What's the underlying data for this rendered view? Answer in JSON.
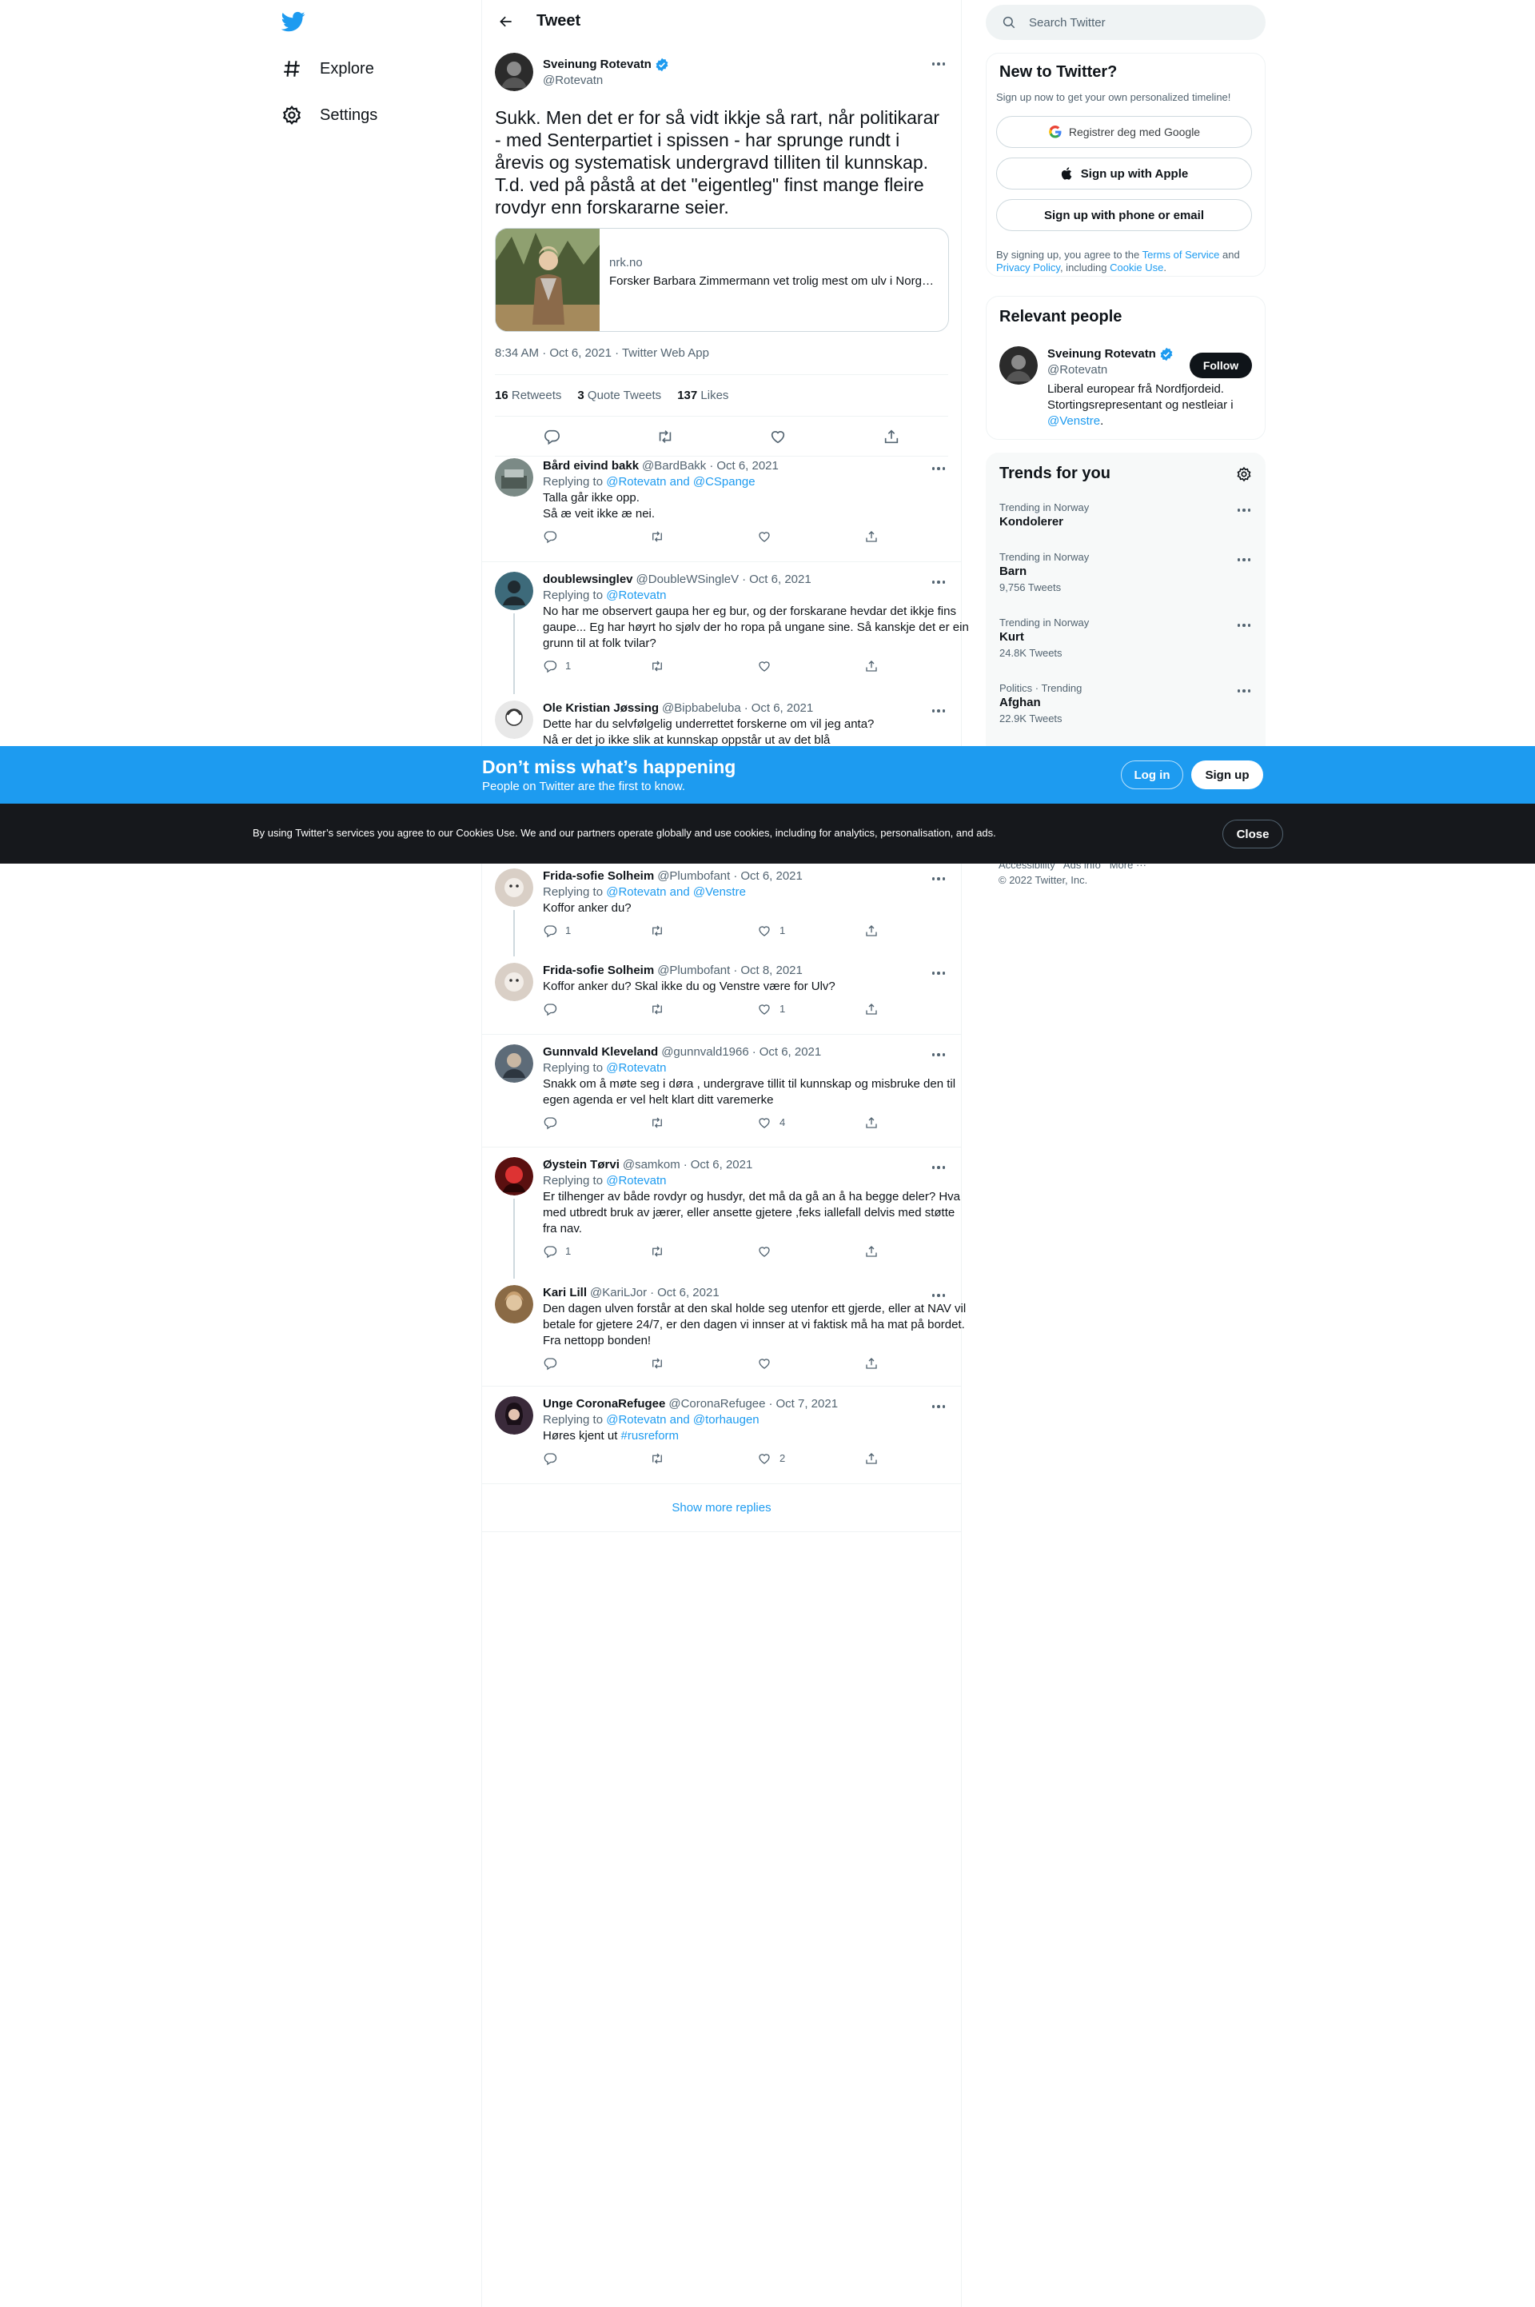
{
  "nav": {
    "items": [
      {
        "label": "Explore",
        "icon": "hashtag-icon"
      },
      {
        "label": "Settings",
        "icon": "gear-icon"
      }
    ]
  },
  "header": {
    "title": "Tweet"
  },
  "main_tweet": {
    "name": "Sveinung Rotevatn",
    "handle": "@Rotevatn",
    "text": "Sukk. Men det er for så vidt ikkje så rart, når politikarar - med Senterpartiet i spissen - har sprunge rundt i årevis og systematisk undergravd tilliten til kunnskap. T.d. ved på påstå at det \"eigentleg\" finst mange fleire rovdyr enn forskararne seier.",
    "card": {
      "domain": "nrk.no",
      "title": "Forsker Barbara Zimmermann vet trolig mest om ulv i Norge …"
    },
    "meta": "8:34 AM · Oct 6, 2021 · Twitter Web App",
    "stats": {
      "retweets_count": "16",
      "retweets_label": "Retweets",
      "quotes_count": "3",
      "quotes_label": "Quote Tweets",
      "likes_count": "137",
      "likes_label": "Likes"
    }
  },
  "replies": [
    {
      "name": "Bård eivind bakk",
      "handle": "@BardBakk",
      "date": "Oct 6, 2021",
      "replying_prefix": "Replying to ",
      "replying_to": "@Rotevatn and @CSpange",
      "text": "Talla går ikke opp.\nSå æ veit ikke æ nei.",
      "reply_count": "",
      "like_count": ""
    },
    {
      "name": "doublewsinglev",
      "handle": "@DoubleWSingleV",
      "date": "Oct 6, 2021",
      "replying_prefix": "Replying to ",
      "replying_to": "@Rotevatn",
      "text": "No har me observert gaupa her eg bur, og der forskarane hevdar det ikkje fins gaupe... Eg har høyrt ho sjølv der ho ropa på ungane sine. Så kanskje det er ein grunn til at folk tvilar?",
      "reply_count": "1",
      "like_count": ""
    },
    {
      "name": "Ole Kristian Jøssing",
      "handle": "@Bipbabeluba",
      "date": "Oct 6, 2021",
      "text": "Dette har du selvfølgelig underrettet forskerne om vil jeg anta?\nNå er det jo ikke slik at kunnskap oppstår ut av det blå"
    },
    {
      "name": "Frida-sofie Solheim",
      "handle": "@Plumbofant",
      "date": "Oct 6, 2021",
      "replying_prefix": "Replying to ",
      "replying_to": "@Rotevatn and @Venstre",
      "text": "Koffor anker du?",
      "reply_count": "1",
      "like_count": "1"
    },
    {
      "name": "Frida-sofie Solheim",
      "handle": "@Plumbofant",
      "date": "Oct 8, 2021",
      "text": "Koffor anker du? Skal ikke du og Venstre være for Ulv?",
      "reply_count": "",
      "like_count": "1"
    },
    {
      "name": "Gunnvald Kleveland",
      "handle": "@gunnvald1966",
      "date": "Oct 6, 2021",
      "replying_prefix": "Replying to ",
      "replying_to": "@Rotevatn",
      "text": "Snakk om å møte seg i døra , undergrave tillit til kunnskap og misbruke den til egen agenda er vel helt klart ditt varemerke",
      "reply_count": "",
      "like_count": "4"
    },
    {
      "name": "Øystein Tørvi",
      "handle": "@samkom",
      "date": "Oct 6, 2021",
      "replying_prefix": "Replying to ",
      "replying_to": "@Rotevatn",
      "text": "Er tilhenger av både rovdyr og husdyr, det må da gå an å ha begge deler? Hva med utbredt bruk av jærer, eller ansette gjetere ,feks iallefall delvis med støtte fra nav.",
      "reply_count": "1",
      "like_count": ""
    },
    {
      "name": "Kari Lill",
      "handle": "@KariLJor",
      "date": "Oct 6, 2021",
      "text": "Den dagen ulven forstår at den skal holde seg utenfor ett gjerde, eller at NAV vil betale for gjetere 24/7, er den dagen vi innser at vi faktisk må ha mat på bordet. Fra nettopp bonden!",
      "reply_count": "",
      "like_count": ""
    },
    {
      "name": "Unge CoronaRefugee",
      "handle": "@CoronaRefugee",
      "date": "Oct 7, 2021",
      "replying_prefix": "Replying to ",
      "replying_to": "@Rotevatn and @torhaugen",
      "text_prefix": "Høres kjent ut ",
      "hashtag": "#rusreform",
      "reply_count": "",
      "like_count": "2"
    }
  ],
  "show_more": "Show more replies",
  "search": {
    "placeholder": "Search Twitter"
  },
  "new_to_twitter": {
    "title": "New to Twitter?",
    "subtitle": "Sign up now to get your own personalized timeline!",
    "google_btn": "Registrer deg med Google",
    "apple_btn": "Sign up with Apple",
    "phone_btn": "Sign up with phone or email",
    "terms_1": "By signing up, you agree to the ",
    "terms_link": "Terms of Service",
    "terms_2": " and ",
    "privacy_link": "Privacy Policy",
    "terms_3": ", including ",
    "cookie_link": "Cookie Use",
    "terms_4": "."
  },
  "relevant_people": {
    "title": "Relevant people",
    "name": "Sveinung Rotevatn",
    "handle": "@Rotevatn",
    "follow": "Follow",
    "bio": "Liberal europear frå Nordfjordeid. Stortingsrepresentant og nestleiar i ",
    "bio_link": "@Venstre",
    "bio_end": "."
  },
  "trends": {
    "title": "Trends for you",
    "items": [
      {
        "context": "Trending in Norway",
        "name": "Kondolerer",
        "count": ""
      },
      {
        "context": "Trending in Norway",
        "name": "Barn",
        "count": "9,756 Tweets"
      },
      {
        "context": "Trending in Norway",
        "name": "Kurt",
        "count": "24.8K Tweets"
      },
      {
        "context": "Politics · Trending",
        "name": "Afghan",
        "count": "22.9K Tweets"
      }
    ]
  },
  "footer": {
    "links": "Accessibility   Ads info   More ···",
    "copyright": "© 2022 Twitter, Inc."
  },
  "banner": {
    "heading": "Don’t miss what’s happening",
    "sub": "People on Twitter are the first to know.",
    "login": "Log in",
    "signup": "Sign up"
  },
  "cookie_bar": {
    "text": "By using Twitter’s services you agree to our Cookies Use. We and our partners operate globally and use cookies, including for analytics, personalisation, and ads.",
    "close": "Close"
  },
  "colors": {
    "accent": "#1d9bf0",
    "text": "#0f1419",
    "secondary": "#536471",
    "border": "#eff3f4",
    "dark_bar": "#16181c"
  }
}
